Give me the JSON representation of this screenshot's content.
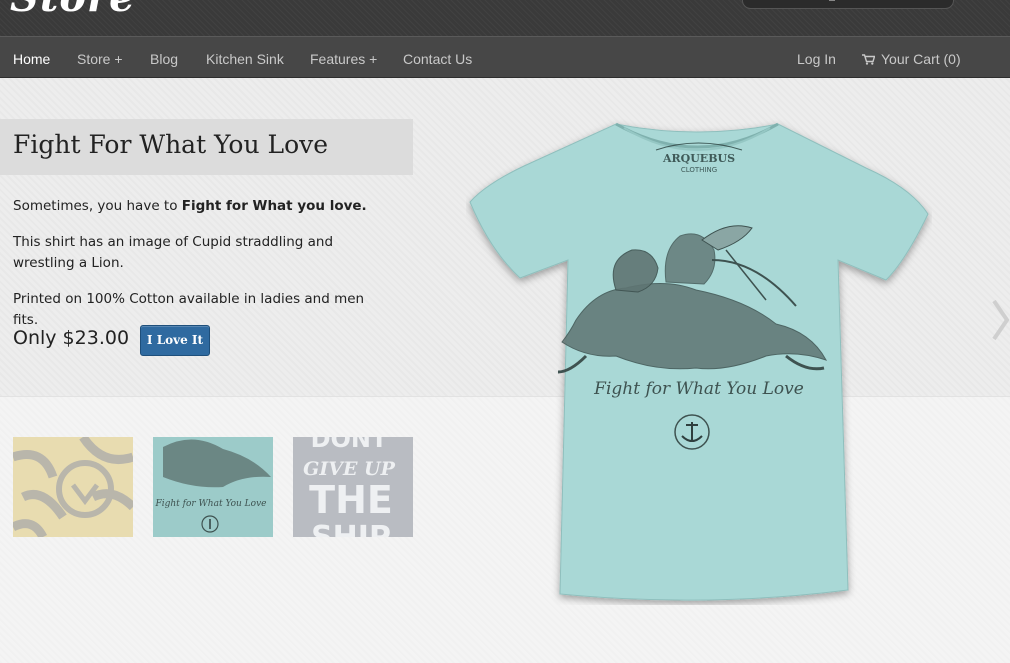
{
  "header": {
    "logo_text": "Store"
  },
  "nav": {
    "left": [
      {
        "label": "Home",
        "active": true
      },
      {
        "label": "Store +"
      },
      {
        "label": "Blog"
      },
      {
        "label": "Kitchen Sink"
      },
      {
        "label": "Features +"
      },
      {
        "label": "Contact Us"
      }
    ],
    "login_label": "Log In",
    "cart_label": "Your Cart (0)"
  },
  "product": {
    "title": "Fight For What You Love",
    "intro_prefix": "Sometimes, you have to ",
    "intro_bold": "Fight for What you love.",
    "description": "This shirt has an image of Cupid straddling and wrestling a Lion.",
    "material": "Printed on 100% Cotton available in ladies and men fits.",
    "price": "Only $23.00",
    "button_label": "I Love It"
  },
  "shirt_print": {
    "brand": "ARQUEBUS",
    "brand_sub": "CLOTHING",
    "slogan": "Fight for What You Love"
  },
  "thumbnails": [
    {
      "name": "tiger shirt",
      "color": "#e8dcb0"
    },
    {
      "name": "fight for what you love shirt",
      "caption": "Fight for What You Love",
      "color": "#9ccbc9"
    },
    {
      "name": "dont give up the ship shirt",
      "lines": [
        "DONT",
        "GIVE UP",
        "THE",
        "SHIP"
      ],
      "color": "#b9bcc2"
    }
  ],
  "colors": {
    "nav_bg": "#474747",
    "button": "#2f6aa0",
    "shirt": "#a9d8d6"
  }
}
